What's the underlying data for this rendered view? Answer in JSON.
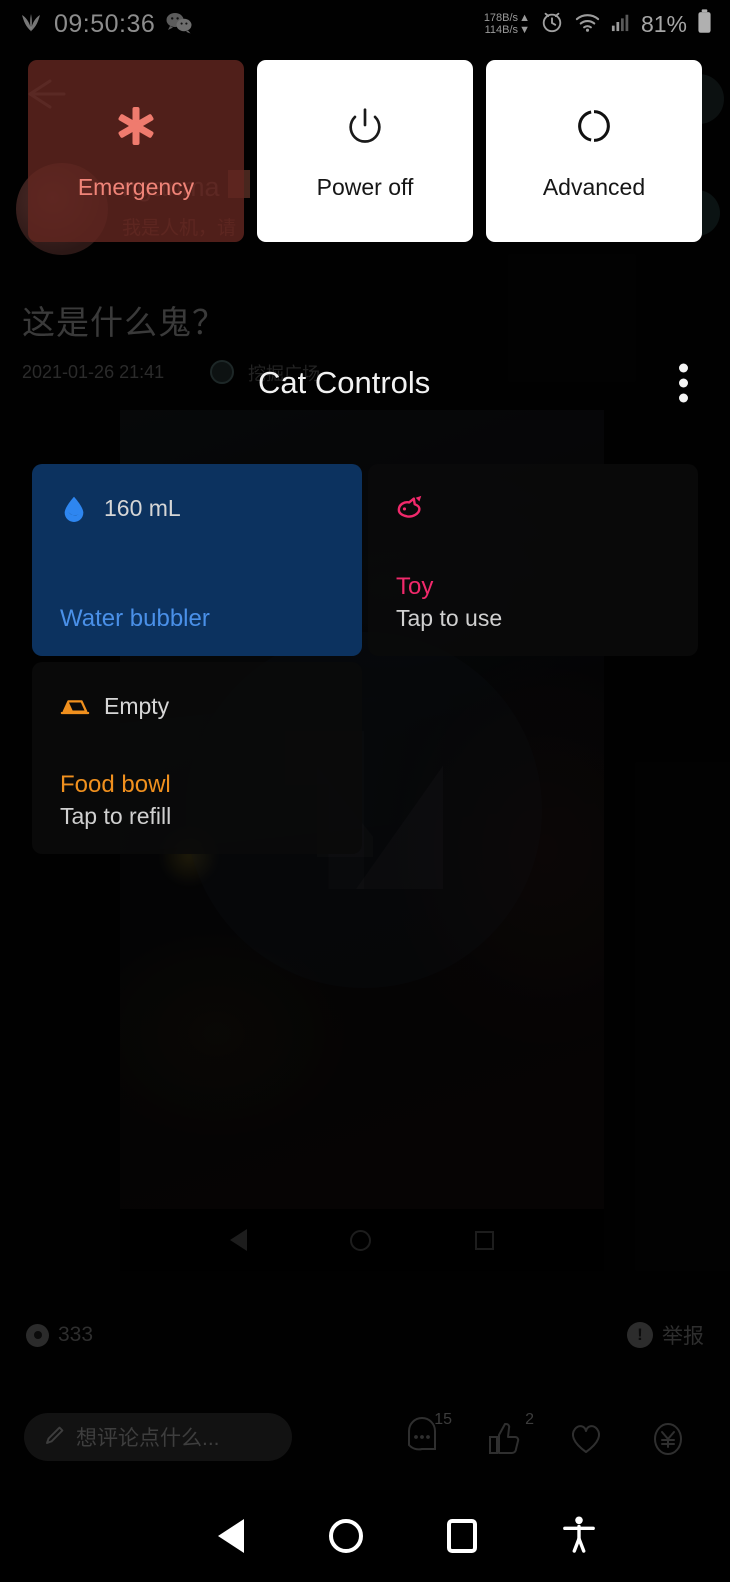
{
  "statusbar": {
    "time": "09:50:36",
    "leaf_icon": "leaf-icon",
    "chat_icon": "wechat-icon",
    "net_up": "178B/s",
    "net_down": "114B/s",
    "alarm_icon": "alarm-clock-icon",
    "wifi_icon": "wifi-icon",
    "signal_icon": "cellular-signal-icon",
    "battery_percent": "81%",
    "battery_icon": "battery-icon"
  },
  "power_menu": {
    "cards": [
      {
        "label": "Emergency",
        "icon": "medical-asterisk-icon",
        "style": "emergency"
      },
      {
        "label": "Power off",
        "icon": "power-icon",
        "style": "light"
      },
      {
        "label": "Advanced",
        "icon": "restart-icon",
        "style": "light"
      }
    ]
  },
  "panel": {
    "title": "Cat Controls",
    "overflow_icon": "more-vertical-icon",
    "tiles": [
      {
        "name": "Water bubbler",
        "status": "160 mL",
        "sub": "",
        "icon": "water-drop-icon",
        "state": "on",
        "accent": "#4a90e8"
      },
      {
        "name": "Toy",
        "status": "",
        "sub": "Tap to use",
        "icon": "fish-icon",
        "state": "off",
        "accent": "#f0296b"
      },
      {
        "name": "Food bowl",
        "status": "Empty",
        "sub": "Tap to refill",
        "icon": "food-bowl-icon",
        "state": "off",
        "accent": "#f0901e"
      }
    ]
  },
  "background_app": {
    "post_title": "这是什么鬼？",
    "post_date": "2021-01-26 21:41",
    "post_source": "挖掘广场",
    "username": "nganma",
    "user_sub": "我是人机，请",
    "back_icon": "back-arrow-icon",
    "view_count": "333",
    "view_icon": "eye-icon",
    "report_label": "举报",
    "report_icon": "warning-icon",
    "comment_placeholder": "想评论点什么...",
    "comment_pencil_icon": "pencil-icon",
    "action_icons": [
      {
        "icon": "comment-bubble-icon",
        "count": "15"
      },
      {
        "icon": "thumbs-up-icon",
        "count": "2"
      },
      {
        "icon": "heart-icon",
        "count": ""
      },
      {
        "icon": "yen-reward-icon",
        "count": ""
      }
    ]
  },
  "sysnav": {
    "back_icon": "nav-back-icon",
    "home_icon": "nav-home-icon",
    "recents_icon": "nav-recents-icon",
    "accessibility_icon": "accessibility-icon"
  }
}
